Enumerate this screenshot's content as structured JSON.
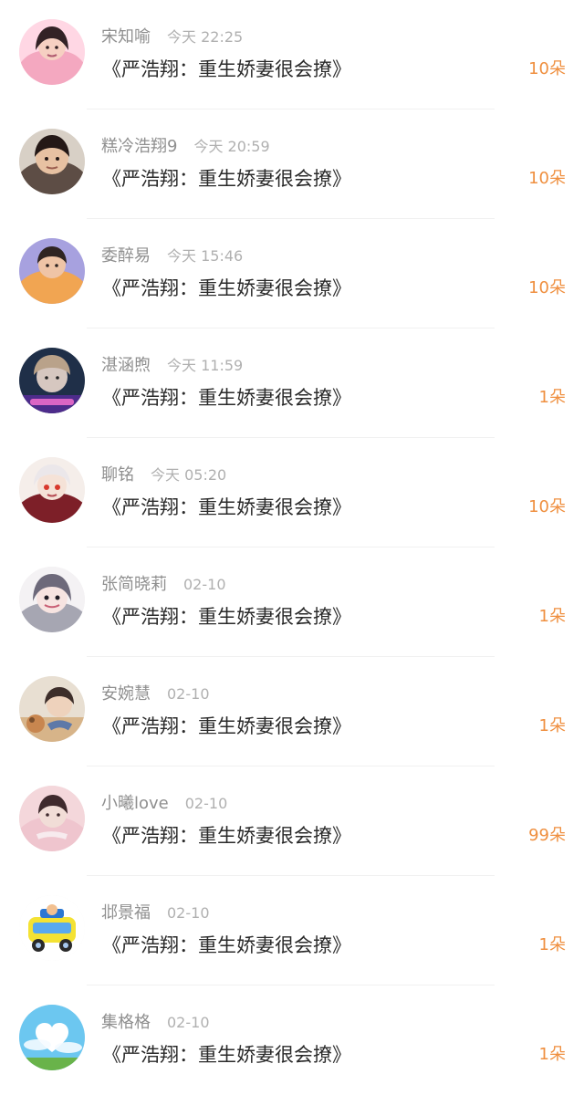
{
  "items": [
    {
      "name": "宋知喻",
      "time": "今天 22:25",
      "title": "《严浩翔：重生娇妻很会撩》",
      "amount": "10朵",
      "avatar": "girl-pink-avatar"
    },
    {
      "name": "糕冷浩翔9",
      "time": "今天 20:59",
      "title": "《严浩翔：重生娇妻很会撩》",
      "amount": "10朵",
      "avatar": "boy-face-avatar"
    },
    {
      "name": "委醉易",
      "time": "今天 15:46",
      "title": "《严浩翔：重生娇妻很会撩》",
      "amount": "10朵",
      "avatar": "boy-purple-bg-avatar"
    },
    {
      "name": "湛涵煦",
      "time": "今天 11:59",
      "title": "《严浩翔：重生娇妻很会撩》",
      "amount": "1朵",
      "avatar": "boy-dark-bg-avatar"
    },
    {
      "name": "聊铭",
      "time": "今天 05:20",
      "title": "《严浩翔：重生娇妻很会撩》",
      "amount": "10朵",
      "avatar": "anime-boy-avatar"
    },
    {
      "name": "张简晓莉",
      "time": "02-10",
      "title": "《严浩翔：重生娇妻很会撩》",
      "amount": "1朵",
      "avatar": "anime-girl-avatar"
    },
    {
      "name": "安婉慧",
      "time": "02-10",
      "title": "《严浩翔：重生娇妻很会撩》",
      "amount": "1朵",
      "avatar": "boy-dog-avatar"
    },
    {
      "name": "小曦love",
      "time": "02-10",
      "title": "《严浩翔：重生娇妻很会撩》",
      "amount": "99朵",
      "avatar": "boy-pink-avatar"
    },
    {
      "name": "邶景福",
      "time": "02-10",
      "title": "《严浩翔：重生娇妻很会撩》",
      "amount": "1朵",
      "avatar": "toy-car-avatar"
    },
    {
      "name": "集格格",
      "time": "02-10",
      "title": "《严浩翔：重生娇妻很会撩》",
      "amount": "1朵",
      "avatar": "sky-heart-avatar"
    }
  ]
}
